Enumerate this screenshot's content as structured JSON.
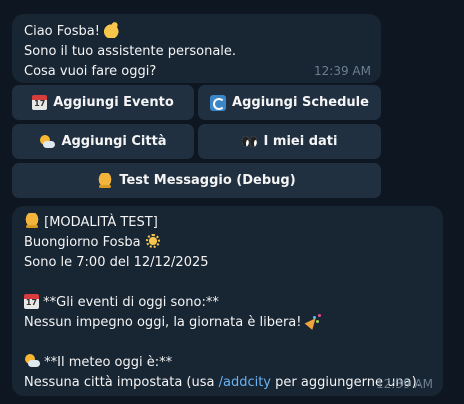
{
  "messages": [
    {
      "lines": [
        "Ciao Fosba!",
        "Sono il tuo assistente personale.",
        "Cosa vuoi fare oggi?"
      ],
      "time": "12:39 AM"
    },
    {
      "header": "[MODALITÀ TEST]",
      "greeting": "Buongiorno Fosba",
      "time_line": "Sono le 7:00 del 12/12/2025",
      "events_title": "**Gli eventi di oggi sono:**",
      "events_text": "Nessun impegno oggi, la giornata è libera!",
      "weather_title": "**Il meteo oggi è:**",
      "weather_text_prefix": "Nessuna città impostata (usa ",
      "weather_link": "/addcity",
      "weather_text_suffix": " per aggiungerne una).",
      "time": "12:39 AM"
    }
  ],
  "keyboard": {
    "add_event": {
      "label": "Aggiungi Evento",
      "icon": "calendar-icon"
    },
    "add_schedule": {
      "label": "Aggiungi Schedule",
      "icon": "refresh-icon"
    },
    "add_city": {
      "label": "Aggiungi Città",
      "icon": "sun-behind-cloud-icon"
    },
    "my_data": {
      "label": "I miei dati",
      "icon": "eyes-icon"
    },
    "test_message": {
      "label": "Test Messaggio (Debug)",
      "icon": "bell-icon"
    }
  },
  "colors": {
    "background": "#0e1621",
    "bubble": "#182533",
    "button": "#203040",
    "link": "#6ab3f3",
    "timestamp": "#6d7f8f"
  }
}
